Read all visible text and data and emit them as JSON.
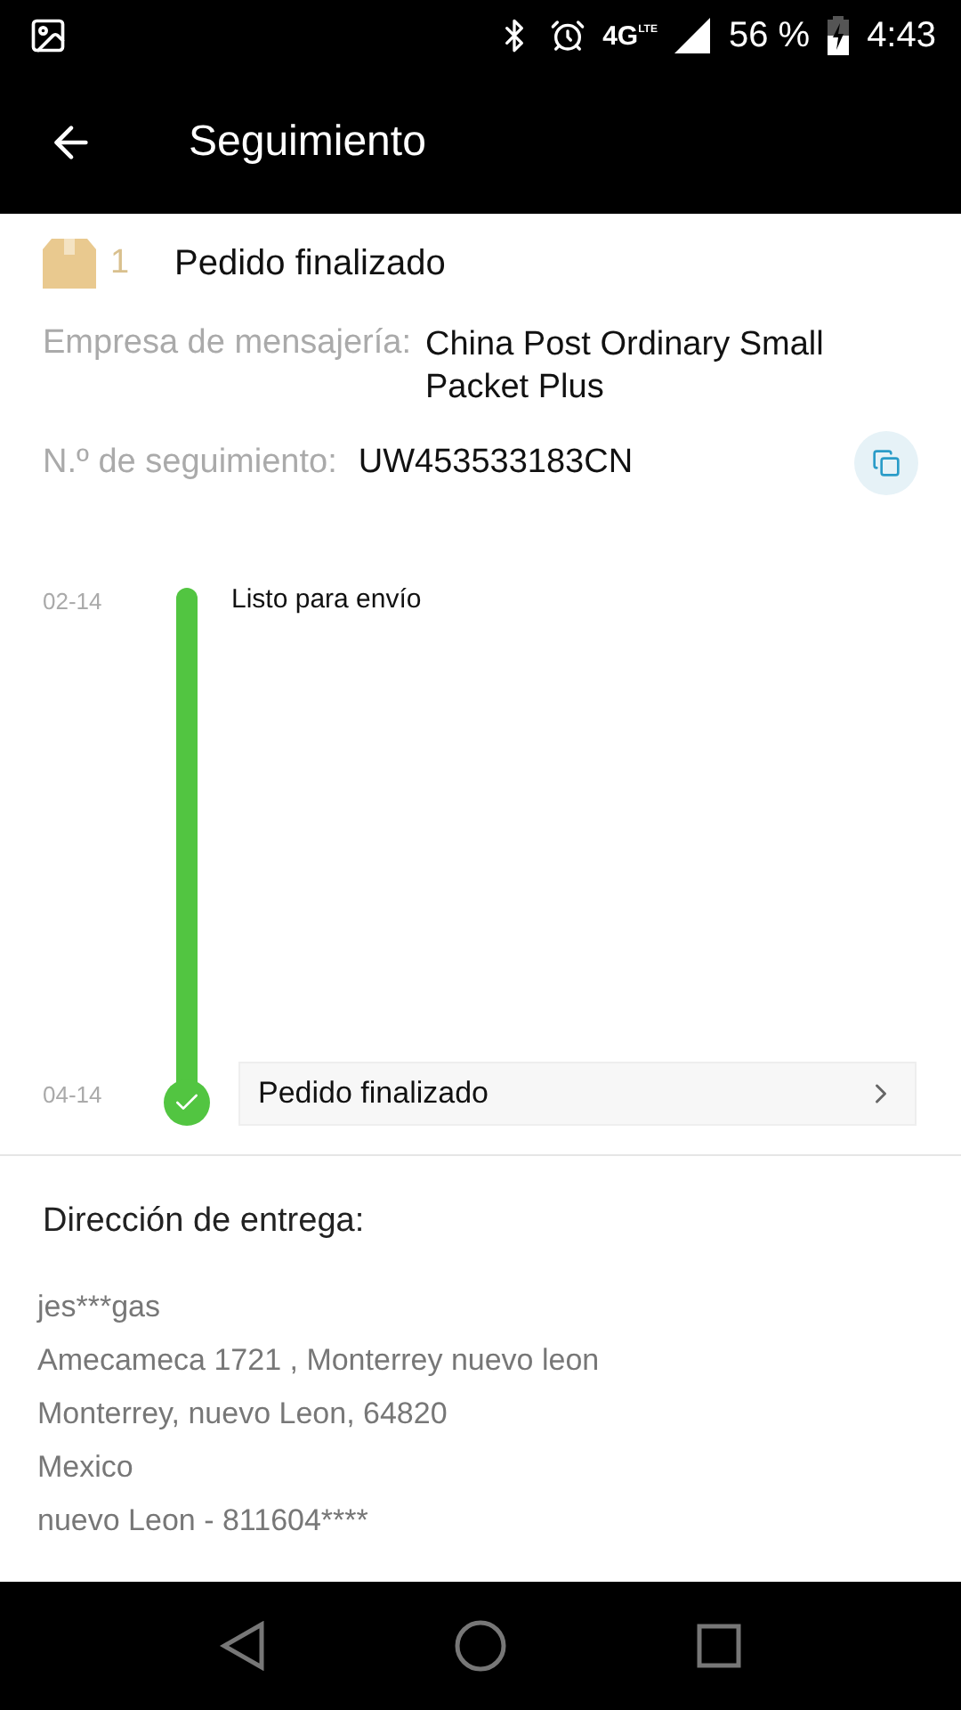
{
  "status_bar": {
    "network": "4G",
    "network_sub": "LTE",
    "battery": "56 %",
    "time": "4:43"
  },
  "app_bar": {
    "title": "Seguimiento"
  },
  "package": {
    "count": "1",
    "status": "Pedido finalizado",
    "carrier_label": "Empresa de mensajería:",
    "carrier": "China Post Ordinary Small Packet Plus",
    "tracking_label": "N.º de seguimiento:",
    "tracking_number": "UW453533183CN"
  },
  "timeline": [
    {
      "kind": "plain",
      "date": "02-14",
      "text": "Listo para envío"
    },
    {
      "kind": "card",
      "date": "04-14",
      "text": "Pedido finalizado"
    }
  ],
  "address": {
    "title": "Dirección de entrega:",
    "lines": [
      "jes***gas",
      "Amecameca 1721 , Monterrey nuevo leon",
      "Monterrey, nuevo Leon, 64820",
      "Mexico",
      "nuevo Leon - 811604****"
    ]
  }
}
